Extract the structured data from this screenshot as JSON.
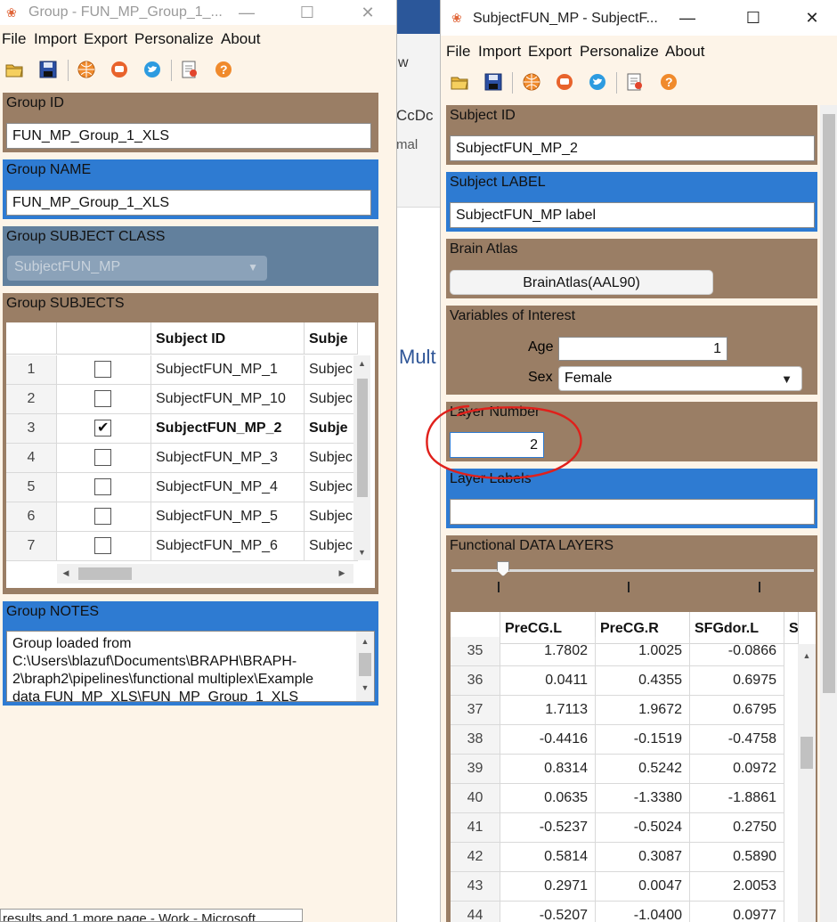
{
  "left_window": {
    "title": "Group - FUN_MP_Group_1_...",
    "menu": [
      "File",
      "Import",
      "Export",
      "Personalize",
      "About"
    ],
    "group_id": {
      "label": "Group ID",
      "value": "FUN_MP_Group_1_XLS"
    },
    "group_name": {
      "label": "Group NAME",
      "value": "FUN_MP_Group_1_XLS"
    },
    "subject_class": {
      "label": "Group SUBJECT CLASS",
      "value": "SubjectFUN_MP"
    },
    "subjects": {
      "label": "Group SUBJECTS",
      "headers": [
        "",
        "Subject ID",
        "Subje"
      ],
      "rows": [
        {
          "n": "1",
          "checked": false,
          "id": "SubjectFUN_MP_1",
          "label": "Subjec"
        },
        {
          "n": "2",
          "checked": false,
          "id": "SubjectFUN_MP_10",
          "label": "Subjec"
        },
        {
          "n": "3",
          "checked": true,
          "id": "SubjectFUN_MP_2",
          "label": "Subje"
        },
        {
          "n": "4",
          "checked": false,
          "id": "SubjectFUN_MP_3",
          "label": "Subjec"
        },
        {
          "n": "5",
          "checked": false,
          "id": "SubjectFUN_MP_4",
          "label": "Subjec"
        },
        {
          "n": "6",
          "checked": false,
          "id": "SubjectFUN_MP_5",
          "label": "Subjec"
        },
        {
          "n": "7",
          "checked": false,
          "id": "SubjectFUN_MP_6",
          "label": "Subjec"
        }
      ]
    },
    "notes": {
      "label": "Group NOTES",
      "lines": [
        "Group loaded from",
        "C:\\Users\\blazuf\\Documents\\BRAPH\\BRAPH-",
        "2\\braph2\\pipelines\\functional multiplex\\Example",
        "data FUN_MP_XLS\\FUN_MP_Group_1_XLS"
      ]
    }
  },
  "background_window": {
    "ribbon_text_1": "w",
    "ribbon_text_2": "CcDc",
    "ribbon_text_3": "mal",
    "body_text": "Mult",
    "taskbar_tip": "results and 1 more page - Work - Microsoft"
  },
  "right_window": {
    "title": "SubjectFUN_MP - SubjectF...",
    "menu": [
      "File",
      "Import",
      "Export",
      "Personalize",
      "About"
    ],
    "subject_id": {
      "label": "Subject ID",
      "value": "SubjectFUN_MP_2"
    },
    "subject_label": {
      "label": "Subject LABEL",
      "value": "SubjectFUN_MP label"
    },
    "brain_atlas": {
      "label": "Brain Atlas",
      "button": "BrainAtlas(AAL90)"
    },
    "voi": {
      "label": "Variables of Interest",
      "age_label": "Age",
      "age_value": "1",
      "sex_label": "Sex",
      "sex_value": "Female"
    },
    "layer_number": {
      "label": "Layer Number",
      "value": "2"
    },
    "layer_labels": {
      "label": "Layer Labels",
      "value": ""
    },
    "functional": {
      "label": "Functional DATA LAYERS",
      "headers": [
        "",
        "PreCG.L",
        "PreCG.R",
        "SFGdor.L",
        "S"
      ],
      "rows": [
        [
          "35",
          "1.7802",
          "1.0025",
          "-0.0866"
        ],
        [
          "36",
          "0.0411",
          "0.4355",
          "0.6975"
        ],
        [
          "37",
          "1.7113",
          "1.9672",
          "0.6795"
        ],
        [
          "38",
          "-0.4416",
          "-0.1519",
          "-0.4758"
        ],
        [
          "39",
          "0.8314",
          "0.5242",
          "0.0972"
        ],
        [
          "40",
          "0.0635",
          "-1.3380",
          "-1.8861"
        ],
        [
          "41",
          "-0.5237",
          "-0.5024",
          "0.2750"
        ],
        [
          "42",
          "0.5814",
          "0.3087",
          "0.5890"
        ],
        [
          "43",
          "0.2971",
          "0.0047",
          "2.0053"
        ],
        [
          "44",
          "-0.5207",
          "-1.0400",
          "0.0977"
        ]
      ]
    }
  },
  "colors": {
    "panel_brown": "#9a7e65",
    "panel_blue": "#2e7bd2",
    "panel_slate": "#62809d",
    "window_bg": "#fdf4e8",
    "annotation_red": "#e0201b"
  }
}
